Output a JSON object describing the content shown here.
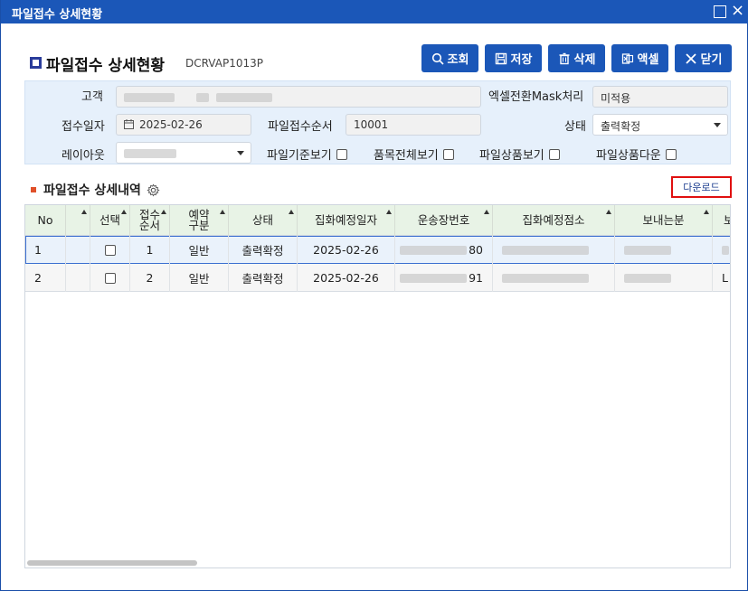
{
  "window": {
    "title": "파일접수 상세현황"
  },
  "page": {
    "title": "파일접수 상세현황",
    "code": "DCRVAP1013P"
  },
  "toolbar": {
    "search": "조회",
    "save": "저장",
    "delete": "삭제",
    "excel": "액셀",
    "close": "닫기"
  },
  "filters": {
    "customer_label": "고객",
    "excel_mask_label": "엑셀전환Mask처리",
    "excel_mask_value": "미적용",
    "receipt_date_label": "접수일자",
    "receipt_date_value": "2025-02-26",
    "file_seq_label": "파일접수순서",
    "file_seq_value": "10001",
    "status_label": "상태",
    "status_value": "출력확정",
    "layout_label": "레이아웃",
    "cb_file_basis": "파일기준보기",
    "cb_all_items": "품목전체보기",
    "cb_file_products": "파일상품보기",
    "cb_file_product_download": "파일상품다운"
  },
  "section": {
    "title": "파일접수 상세내역",
    "download": "다운로드"
  },
  "grid": {
    "columns": {
      "no": "No",
      "select": "선택",
      "seq": "접수\n순서",
      "reserve": "예약\n구분",
      "status": "상태",
      "pickup_date": "집화예정일자",
      "waybill": "운송장번호",
      "pickup_branch": "집화예정점소",
      "sender": "보내는분",
      "extra": "보"
    },
    "rows": [
      {
        "no": "1",
        "seq": "1",
        "reserve": "일반",
        "status": "출력확정",
        "pickup_date": "2025-02-26",
        "waybill_suffix": "80",
        "extra": "L"
      },
      {
        "no": "2",
        "seq": "2",
        "reserve": "일반",
        "status": "출력확정",
        "pickup_date": "2025-02-26",
        "waybill_suffix": "91",
        "extra": "L"
      }
    ]
  },
  "colors": {
    "brand": "#1b57b8",
    "header_bg": "#e8f3e6",
    "filter_bg": "#e6f0fb",
    "highlight": "#e01010"
  }
}
